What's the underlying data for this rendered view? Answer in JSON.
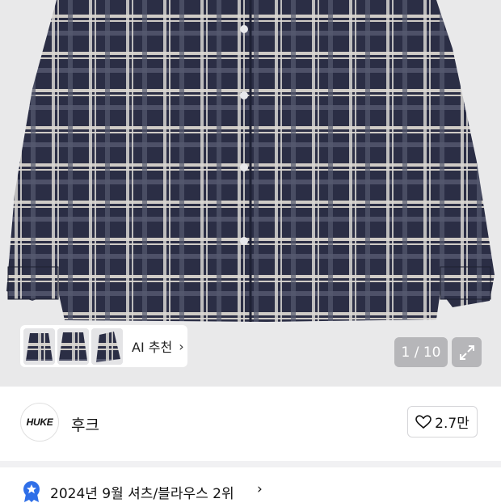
{
  "gallery": {
    "ai_recommend_label": "AI 추천",
    "counter_text": "1 / 10",
    "thumbnails": [
      "shirt-thumbnail-1",
      "shirt-thumbnail-2",
      "shirt-thumbnail-3"
    ]
  },
  "brand": {
    "logo_text": "HUKE",
    "name": "후크",
    "like_count": "2.7만"
  },
  "ranking": {
    "text": "2024년 9월 셔츠/블라우스 2위",
    "chevron": "›"
  },
  "colors": {
    "plaid_navy": "#2b2e45",
    "plaid_light": "#d9d6d2",
    "background": "#ffffff",
    "divider": "#f1f1f3",
    "rank_badge": "#2f6fe8"
  },
  "icons": [
    "chevron-right-icon",
    "expand-icon",
    "heart-icon",
    "rank-badge-icon"
  ]
}
